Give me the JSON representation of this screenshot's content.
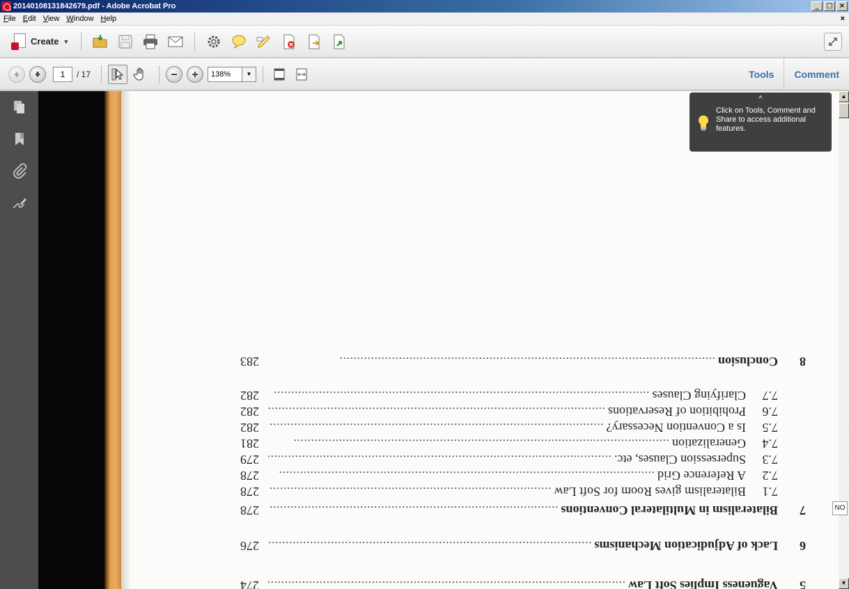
{
  "window": {
    "title": "20140108131842679.pdf - Adobe Acrobat Pro",
    "min": "_",
    "max": "□",
    "close": "×"
  },
  "menu": {
    "items": [
      "File",
      "Edit",
      "View",
      "Window",
      "Help"
    ],
    "close": "×"
  },
  "toolbar": {
    "create_label": "Create"
  },
  "nav": {
    "page_current": "1",
    "page_total": "/ 17",
    "zoom": "138%"
  },
  "panes": {
    "tools": "Tools",
    "comment": "Comment"
  },
  "tooltip": {
    "arrow": "^",
    "text": "Click on Tools, Comment and Share to access additional features."
  },
  "badge": "NO",
  "toc": [
    {
      "num": "8",
      "sub": "",
      "label": "Conclusion",
      "page": "283",
      "chapter": true
    },
    {
      "num": "",
      "sub": "7.7",
      "label": "Clarifying Clauses",
      "page": "282",
      "chapter": false
    },
    {
      "num": "",
      "sub": "7.6",
      "label": "Prohibition of Reservations",
      "page": "282",
      "chapter": false
    },
    {
      "num": "",
      "sub": "7.5",
      "label": "Is a Convention Necessary?",
      "page": "282",
      "chapter": false
    },
    {
      "num": "",
      "sub": "7.4",
      "label": "Generalization",
      "page": "281",
      "chapter": false
    },
    {
      "num": "",
      "sub": "7.3",
      "label": "Supersession Clauses, etc.",
      "page": "279",
      "chapter": false
    },
    {
      "num": "",
      "sub": "7.2",
      "label": "A Reference Grid",
      "page": "278",
      "chapter": false
    },
    {
      "num": "",
      "sub": "7.1",
      "label": "Bilateralism gives Room for Soft Law",
      "page": "278",
      "chapter": false
    },
    {
      "num": "7",
      "sub": "",
      "label": "Bilateralism in Multilateral Conventions",
      "page": "278",
      "chapter": true
    },
    {
      "num": "6",
      "sub": "",
      "label": "Lack of Adjudication Mechanisms",
      "page": "276",
      "chapter": true
    },
    {
      "num": "5",
      "sub": "",
      "label": "Vagueness Implies Soft Law",
      "page": "274",
      "chapter": true
    }
  ]
}
